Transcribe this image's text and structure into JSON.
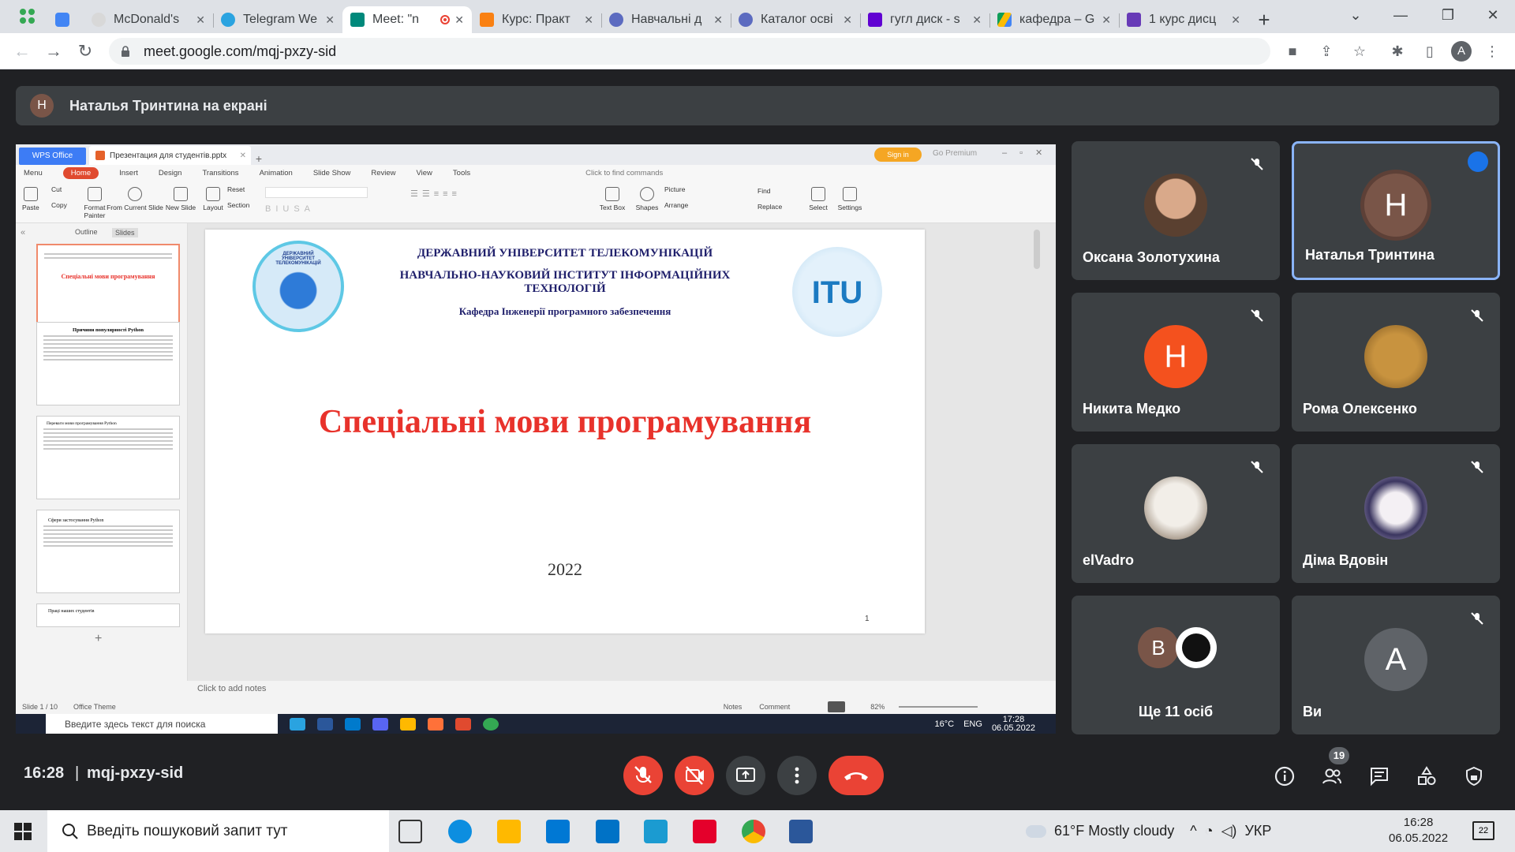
{
  "browser": {
    "tabs": [
      {
        "label": "McDonald's",
        "favicon": "chrome-icon"
      },
      {
        "label": "Telegram We",
        "favicon": "telegram-icon"
      },
      {
        "label": "Meet: \"n",
        "favicon": "meet-icon",
        "active": true
      },
      {
        "label": "Курс: Практ",
        "favicon": "moodle-icon"
      },
      {
        "label": "Навчальні д",
        "favicon": "gear-icon"
      },
      {
        "label": "Каталог осві",
        "favicon": "gear-icon"
      },
      {
        "label": "гугл диск - s",
        "favicon": "yahoo-icon"
      },
      {
        "label": "кафедра – G",
        "favicon": "drive-icon"
      },
      {
        "label": "1 курс дисц",
        "favicon": "forms-icon"
      }
    ],
    "url": "meet.google.com/mqj-pxzy-sid",
    "profile_initial": "A"
  },
  "meet": {
    "presenter_initial": "Н",
    "presenter_label": "Наталья Тринтина на екрані",
    "clock": "16:28",
    "meeting_code": "mqj-pxzy-sid",
    "participants_count": "19",
    "participants": [
      {
        "name": "Оксана Золотухина",
        "kind": "photo",
        "muted": true
      },
      {
        "name": "Наталья Тринтина",
        "kind": "initial",
        "initial": "Н",
        "color": "#795548",
        "speaking": true
      },
      {
        "name": "Никита Медко",
        "kind": "initial",
        "initial": "Н",
        "color": "#f4511e",
        "muted": true
      },
      {
        "name": "Рома Олексенко",
        "kind": "photo",
        "muted": true
      },
      {
        "name": "elVadro",
        "kind": "photo",
        "muted": true
      },
      {
        "name": "Діма Вдовін",
        "kind": "photo",
        "muted": true
      },
      {
        "name": "Ще 11 осіб",
        "kind": "group",
        "initial": "B"
      },
      {
        "name": "Ви",
        "kind": "initial",
        "initial": "A",
        "color": "#5f6368",
        "muted": true
      }
    ]
  },
  "wps": {
    "app": "WPS Office",
    "doc_tab": "Презентация для студентів.pptx",
    "sign_in": "Sign in",
    "premium": "Go Premium",
    "menu": [
      "Menu",
      "Home",
      "Insert",
      "Design",
      "Transitions",
      "Animation",
      "Slide Show",
      "Review",
      "View",
      "Tools"
    ],
    "find_commands": "Click to find commands",
    "ribbon": [
      "Paste",
      "Cut",
      "Copy",
      "Format Painter",
      "From Current Slide",
      "New Slide",
      "Layout",
      "Reset",
      "Section",
      "Text Box",
      "Shapes",
      "Picture",
      "Arrange",
      "Find",
      "Replace",
      "Select",
      "Settings"
    ],
    "panel_tabs": [
      "Outline",
      "Slides"
    ],
    "notes_placeholder": "Click to add notes",
    "status_left": "Slide 1 / 10",
    "theme": "Office Theme",
    "notes_btn": "Notes",
    "comment_btn": "Comment",
    "zoom": "82%",
    "thumbnails": [
      {
        "num": "1",
        "title": "Спеціальні мови програмування"
      },
      {
        "num": "2",
        "title": "Причини популярності Python"
      },
      {
        "num": "3",
        "title": "Переваги мови програмування Python"
      },
      {
        "num": "4",
        "title": "Сфери застосування Python"
      },
      {
        "num": "5",
        "title": "Праці наших студентів"
      }
    ],
    "slide": {
      "line1": "ДЕРЖАВНИЙ УНІВЕРСИТЕТ ТЕЛЕКОМУНІКАЦІЙ",
      "line2": "НАВЧАЛЬНО-НАУКОВИЙ ІНСТИТУТ ІНФОРМАЦІЙНИХ ТЕХНОЛОГІЙ",
      "line3": "Кафедра Інженерії програмного забезпечення",
      "main_title": "Спеціальні мови програмування",
      "year": "2022",
      "number": "1",
      "logo_left": "ДЕРЖАВНИЙ УНІВЕРСИТЕТ ТЕЛЕКОМУНІКАЦІЙ",
      "logo_right": "ITU"
    },
    "inner_taskbar": {
      "search": "Введите здесь текст для поиска",
      "temp": "16°C",
      "lang": "ENG",
      "time": "17:28",
      "date": "06.05.2022"
    }
  },
  "taskbar": {
    "search": "Введіть пошуковий запит тут",
    "weather": "61°F  Mostly cloudy",
    "lang": "УКР",
    "time": "16:28",
    "date": "06.05.2022",
    "notif": "22"
  }
}
